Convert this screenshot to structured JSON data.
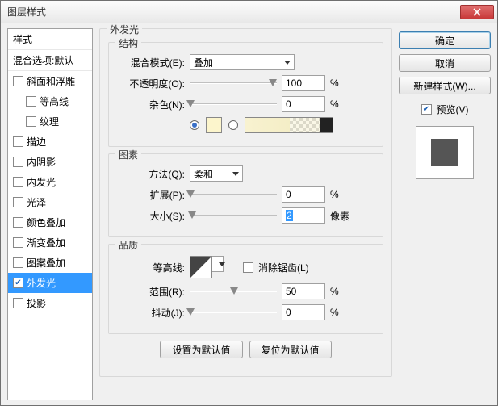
{
  "window": {
    "title": "图层样式"
  },
  "left": {
    "header1": "样式",
    "header2": "混合选项:默认",
    "items": [
      {
        "label": "斜面和浮雕",
        "checked": false,
        "indent": 0
      },
      {
        "label": "等高线",
        "checked": false,
        "indent": 1
      },
      {
        "label": "纹理",
        "checked": false,
        "indent": 1
      },
      {
        "label": "描边",
        "checked": false,
        "indent": 0
      },
      {
        "label": "内阴影",
        "checked": false,
        "indent": 0
      },
      {
        "label": "内发光",
        "checked": false,
        "indent": 0
      },
      {
        "label": "光泽",
        "checked": false,
        "indent": 0
      },
      {
        "label": "颜色叠加",
        "checked": false,
        "indent": 0
      },
      {
        "label": "渐变叠加",
        "checked": false,
        "indent": 0
      },
      {
        "label": "图案叠加",
        "checked": false,
        "indent": 0
      },
      {
        "label": "外发光",
        "checked": true,
        "indent": 0,
        "selected": true
      },
      {
        "label": "投影",
        "checked": false,
        "indent": 0
      }
    ]
  },
  "outer": {
    "legend": "外发光"
  },
  "structure": {
    "legend": "结构",
    "blend_label": "混合模式(E):",
    "blend_value": "叠加",
    "opacity_label": "不透明度(O):",
    "opacity_value": "100",
    "opacity_unit": "%",
    "noise_label": "杂色(N):",
    "noise_value": "0",
    "noise_unit": "%"
  },
  "elements": {
    "legend": "图素",
    "method_label": "方法(Q):",
    "method_value": "柔和",
    "spread_label": "扩展(P):",
    "spread_value": "0",
    "spread_unit": "%",
    "size_label": "大小(S):",
    "size_value": "2",
    "size_unit": "像素"
  },
  "quality": {
    "legend": "品质",
    "contour_label": "等高线:",
    "aa_label": "消除锯齿(L)",
    "range_label": "范围(R):",
    "range_value": "50",
    "range_unit": "%",
    "jitter_label": "抖动(J):",
    "jitter_value": "0",
    "jitter_unit": "%"
  },
  "buttons": {
    "reset_default": "设置为默认值",
    "restore_default": "复位为默认值"
  },
  "right": {
    "ok": "确定",
    "cancel": "取消",
    "new_style": "新建样式(W)...",
    "preview": "预览(V)"
  }
}
